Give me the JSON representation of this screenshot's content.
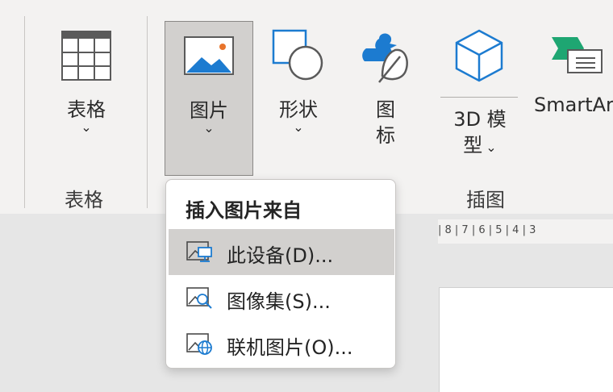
{
  "ribbon": {
    "table_button": {
      "label": "表格",
      "chevron": "⌄",
      "icon": "table-icon"
    },
    "picture_button": {
      "label": "图片",
      "chevron": "⌄",
      "icon": "picture-icon"
    },
    "shapes_button": {
      "label": "形状",
      "chevron": "⌄",
      "icon": "shapes-icon"
    },
    "icons_button": {
      "label_line1": "图",
      "label_line2": "标",
      "icon": "icons-icon"
    },
    "model3d_button": {
      "label_line1": "3D 模",
      "label_line2": "型",
      "chevron": "⌄",
      "icon": "cube-icon"
    },
    "smartart_button": {
      "label": "SmartAr",
      "icon": "smartart-icon"
    },
    "groups": {
      "tables": "表格",
      "illustrations": "插图"
    }
  },
  "ruler": {
    "text": "| 8 | 7 | 6 | 5 | 4 | 3"
  },
  "picture_menu": {
    "header": "插入图片来自",
    "items": [
      {
        "label": "此设备(D)...",
        "icon": "device-picture-icon"
      },
      {
        "label": "图像集(S)...",
        "icon": "stock-images-icon"
      },
      {
        "label": "联机图片(O)...",
        "icon": "online-pictures-icon"
      }
    ]
  },
  "colors": {
    "accent_blue": "#1c7bd0",
    "orange": "#e8742b",
    "pressed": "#d2d0ce"
  }
}
